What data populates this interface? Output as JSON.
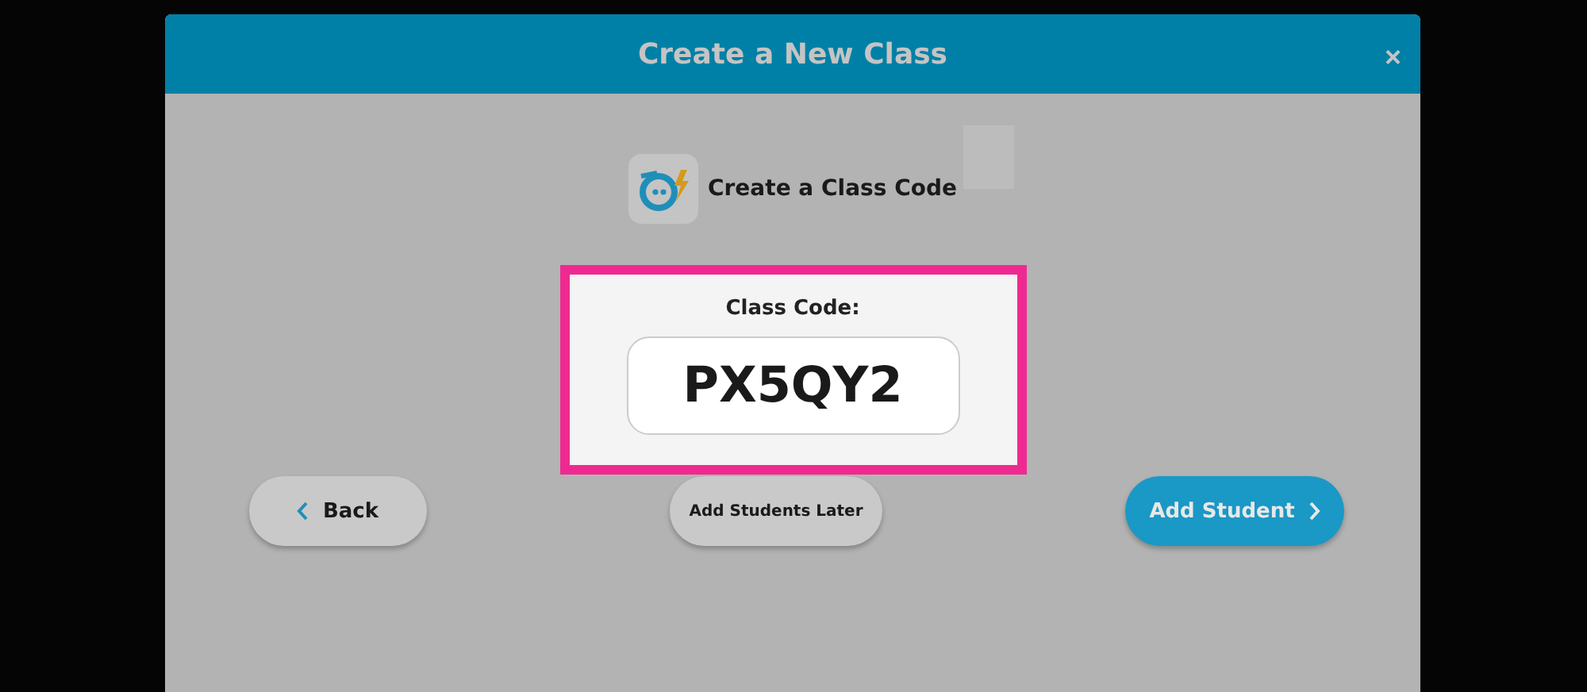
{
  "dialog": {
    "title": "Create a New Class",
    "close": "×"
  },
  "section": {
    "title": "Create a Class Code"
  },
  "class_code": {
    "label": "Class Code:",
    "value": "PX5QY2"
  },
  "buttons": [
    {
      "kind": "back",
      "label": "Back"
    },
    {
      "kind": "plain",
      "label": "Add Students Later"
    },
    {
      "kind": "next",
      "label": "Add Student"
    }
  ]
}
